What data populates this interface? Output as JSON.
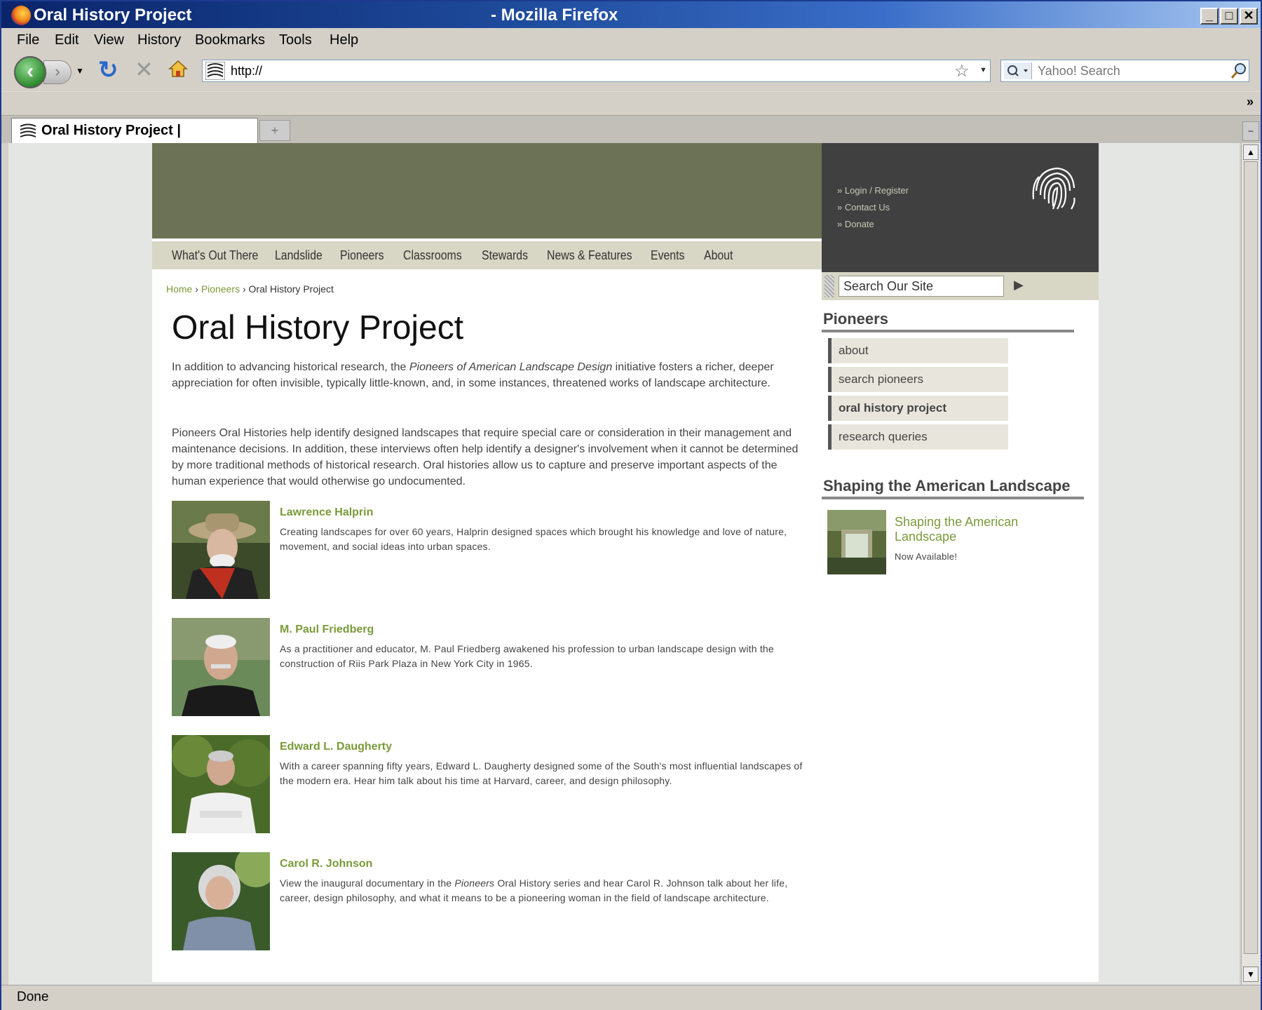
{
  "window": {
    "title": "Oral History Project",
    "app_name": "- Mozilla Firefox",
    "minimize_label": "_",
    "maximize_label": "□",
    "close_label": "✕"
  },
  "menu": [
    "File",
    "Edit",
    "View",
    "History",
    "Bookmarks",
    "Tools",
    "Help"
  ],
  "toolbar": {
    "url": "http://",
    "search_placeholder": "Yahoo! Search",
    "bookmarks_overflow": "»"
  },
  "tab": {
    "label": "Oral History Project |",
    "new_tab": "+"
  },
  "status": {
    "text": "Done"
  },
  "site": {
    "nav": [
      "What's Out There",
      "Landslide",
      "Pioneers",
      "Classrooms",
      "Stewards",
      "News & Features",
      "Events",
      "About"
    ],
    "quick_links": [
      "» Login / Register",
      "» Contact Us",
      "» Donate"
    ],
    "search_placeholder": "Search Our Site"
  },
  "breadcrumb": {
    "home": "Home",
    "sep1": "›",
    "pioneers": "Pioneers",
    "sep2": "›",
    "current": "Oral History Project"
  },
  "main": {
    "title": "Oral History Project",
    "intro_1a": "In addition to advancing historical research, the ",
    "intro_1_italic": "Pioneers of American Landscape Design",
    "intro_1b": " initiative fosters a richer, deeper appreciation for often invisible, typically little-known, and, in some instances, threatened works of landscape architecture.",
    "intro_2": "Pioneers Oral Histories help identify designed landscapes that require special care or consideration in their management and maintenance decisions. In addition, these interviews often help identify a designer's involvement when it cannot be determined by more traditional methods of historical research. Oral histories allow us to capture and preserve important aspects of the human experience that would otherwise go undocumented."
  },
  "people": [
    {
      "name": "Lawrence Halprin",
      "desc": "Creating landscapes for over 60 years, Halprin designed spaces which brought his knowledge and love of nature, movement, and social ideas into urban spaces."
    },
    {
      "name": "M. Paul Friedberg",
      "desc": "As a practitioner and educator, M. Paul Friedberg awakened his profession to urban landscape design with the construction of Riis Park Plaza in New York City in 1965."
    },
    {
      "name": "Edward L. Daugherty",
      "desc": "With a career spanning fifty years, Edward L. Daugherty designed some of the South's most influential landscapes of the modern era. Hear him talk about his time at Harvard, career, and design philosophy."
    },
    {
      "name": "Carol R. Johnson",
      "desc_a": "View the inaugural documentary in the ",
      "desc_italic": "Pioneers",
      "desc_b": " Oral History series and hear Carol R. Johnson talk about her life, career, design philosophy, and what it means to be a pioneering woman in the field of landscape architecture."
    }
  ],
  "sidebar": {
    "heading": "Pioneers",
    "items": [
      "about",
      "search pioneers",
      "oral history project",
      "research queries"
    ],
    "shaping_heading": "Shaping the American Landscape",
    "promo_link_line1": "Shaping the American",
    "promo_link_line2": "Landscape",
    "promo_note": "Now Available!"
  },
  "colors": {
    "accent_green": "#7a9a3a",
    "banner": "#6b7255",
    "dark_panel": "#404040",
    "nav_bg": "#d8d6c5"
  }
}
